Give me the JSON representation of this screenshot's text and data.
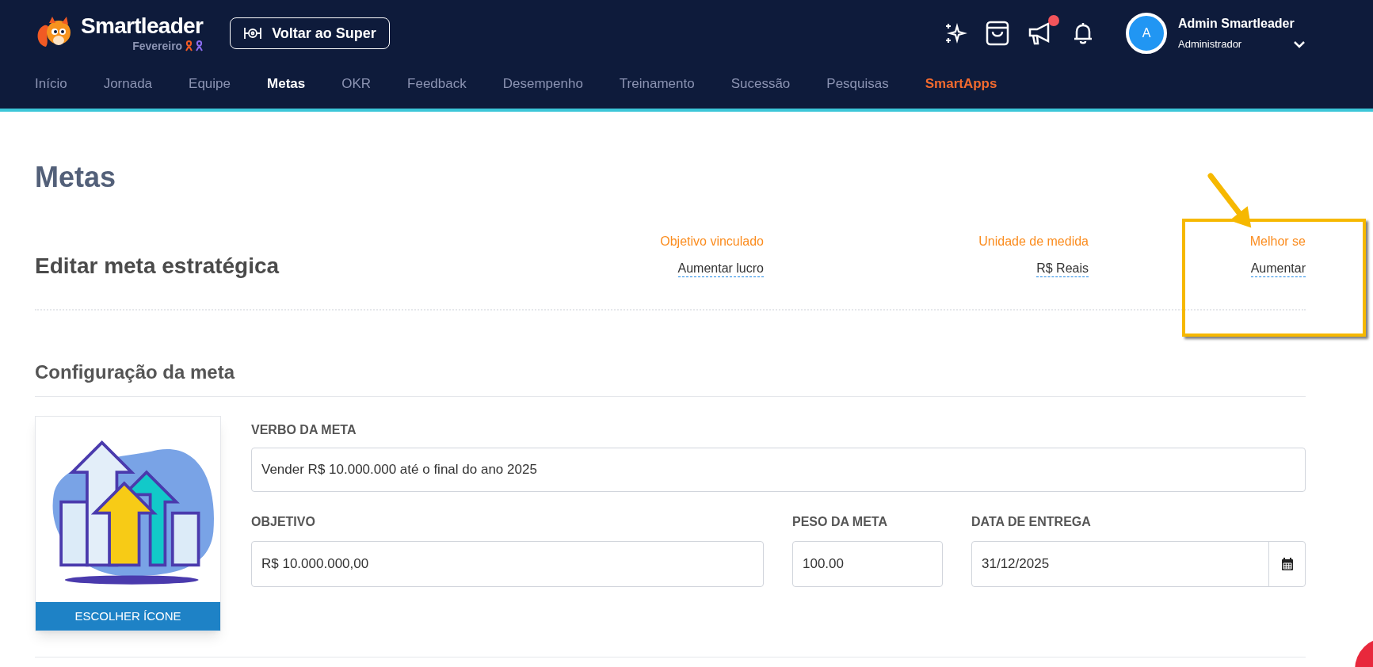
{
  "brand": {
    "name": "Smartleader",
    "month": "Fevereiro"
  },
  "back_button": {
    "label": "Voltar ao Super"
  },
  "notifications": {
    "announcements_unread": true
  },
  "user": {
    "avatar_letter": "A",
    "name": "Admin Smartleader",
    "role": "Administrador"
  },
  "nav": [
    {
      "label": "Início",
      "selected": false,
      "kind": "link"
    },
    {
      "label": "Jornada",
      "selected": false,
      "kind": "link"
    },
    {
      "label": "Equipe",
      "selected": false,
      "kind": "link"
    },
    {
      "label": "Metas",
      "selected": true,
      "kind": "link"
    },
    {
      "label": "OKR",
      "selected": false,
      "kind": "link"
    },
    {
      "label": "Feedback",
      "selected": false,
      "kind": "link"
    },
    {
      "label": "Desempenho",
      "selected": false,
      "kind": "link"
    },
    {
      "label": "Treinamento",
      "selected": false,
      "kind": "link"
    },
    {
      "label": "Sucessão",
      "selected": false,
      "kind": "link"
    },
    {
      "label": "Pesquisas",
      "selected": false,
      "kind": "link"
    },
    {
      "label": "SmartApps",
      "selected": false,
      "kind": "highlight"
    }
  ],
  "page_title": "Metas",
  "edit_header": {
    "title": "Editar meta estratégica",
    "properties": [
      {
        "label": "Objetivo vinculado",
        "value": "Aumentar lucro",
        "annotated": false
      },
      {
        "label": "Unidade de medida",
        "value": "R$ Reais",
        "annotated": false
      },
      {
        "label": "Melhor se",
        "value": "Aumentar",
        "annotated": true
      }
    ]
  },
  "config": {
    "title": "Configuração da meta",
    "icon_button": "ESCOLHER ÍCONE",
    "verb": {
      "label": "VERBO DA META",
      "value": "Vender R$ 10.000.000 até o final do ano 2025"
    },
    "objective": {
      "label": "OBJETIVO",
      "value": "R$ 10.000.000,00"
    },
    "weight": {
      "label": "PESO DA META",
      "value": "100.00"
    },
    "due_date": {
      "label": "DATA DE ENTREGA",
      "value": "31/12/2025"
    }
  }
}
